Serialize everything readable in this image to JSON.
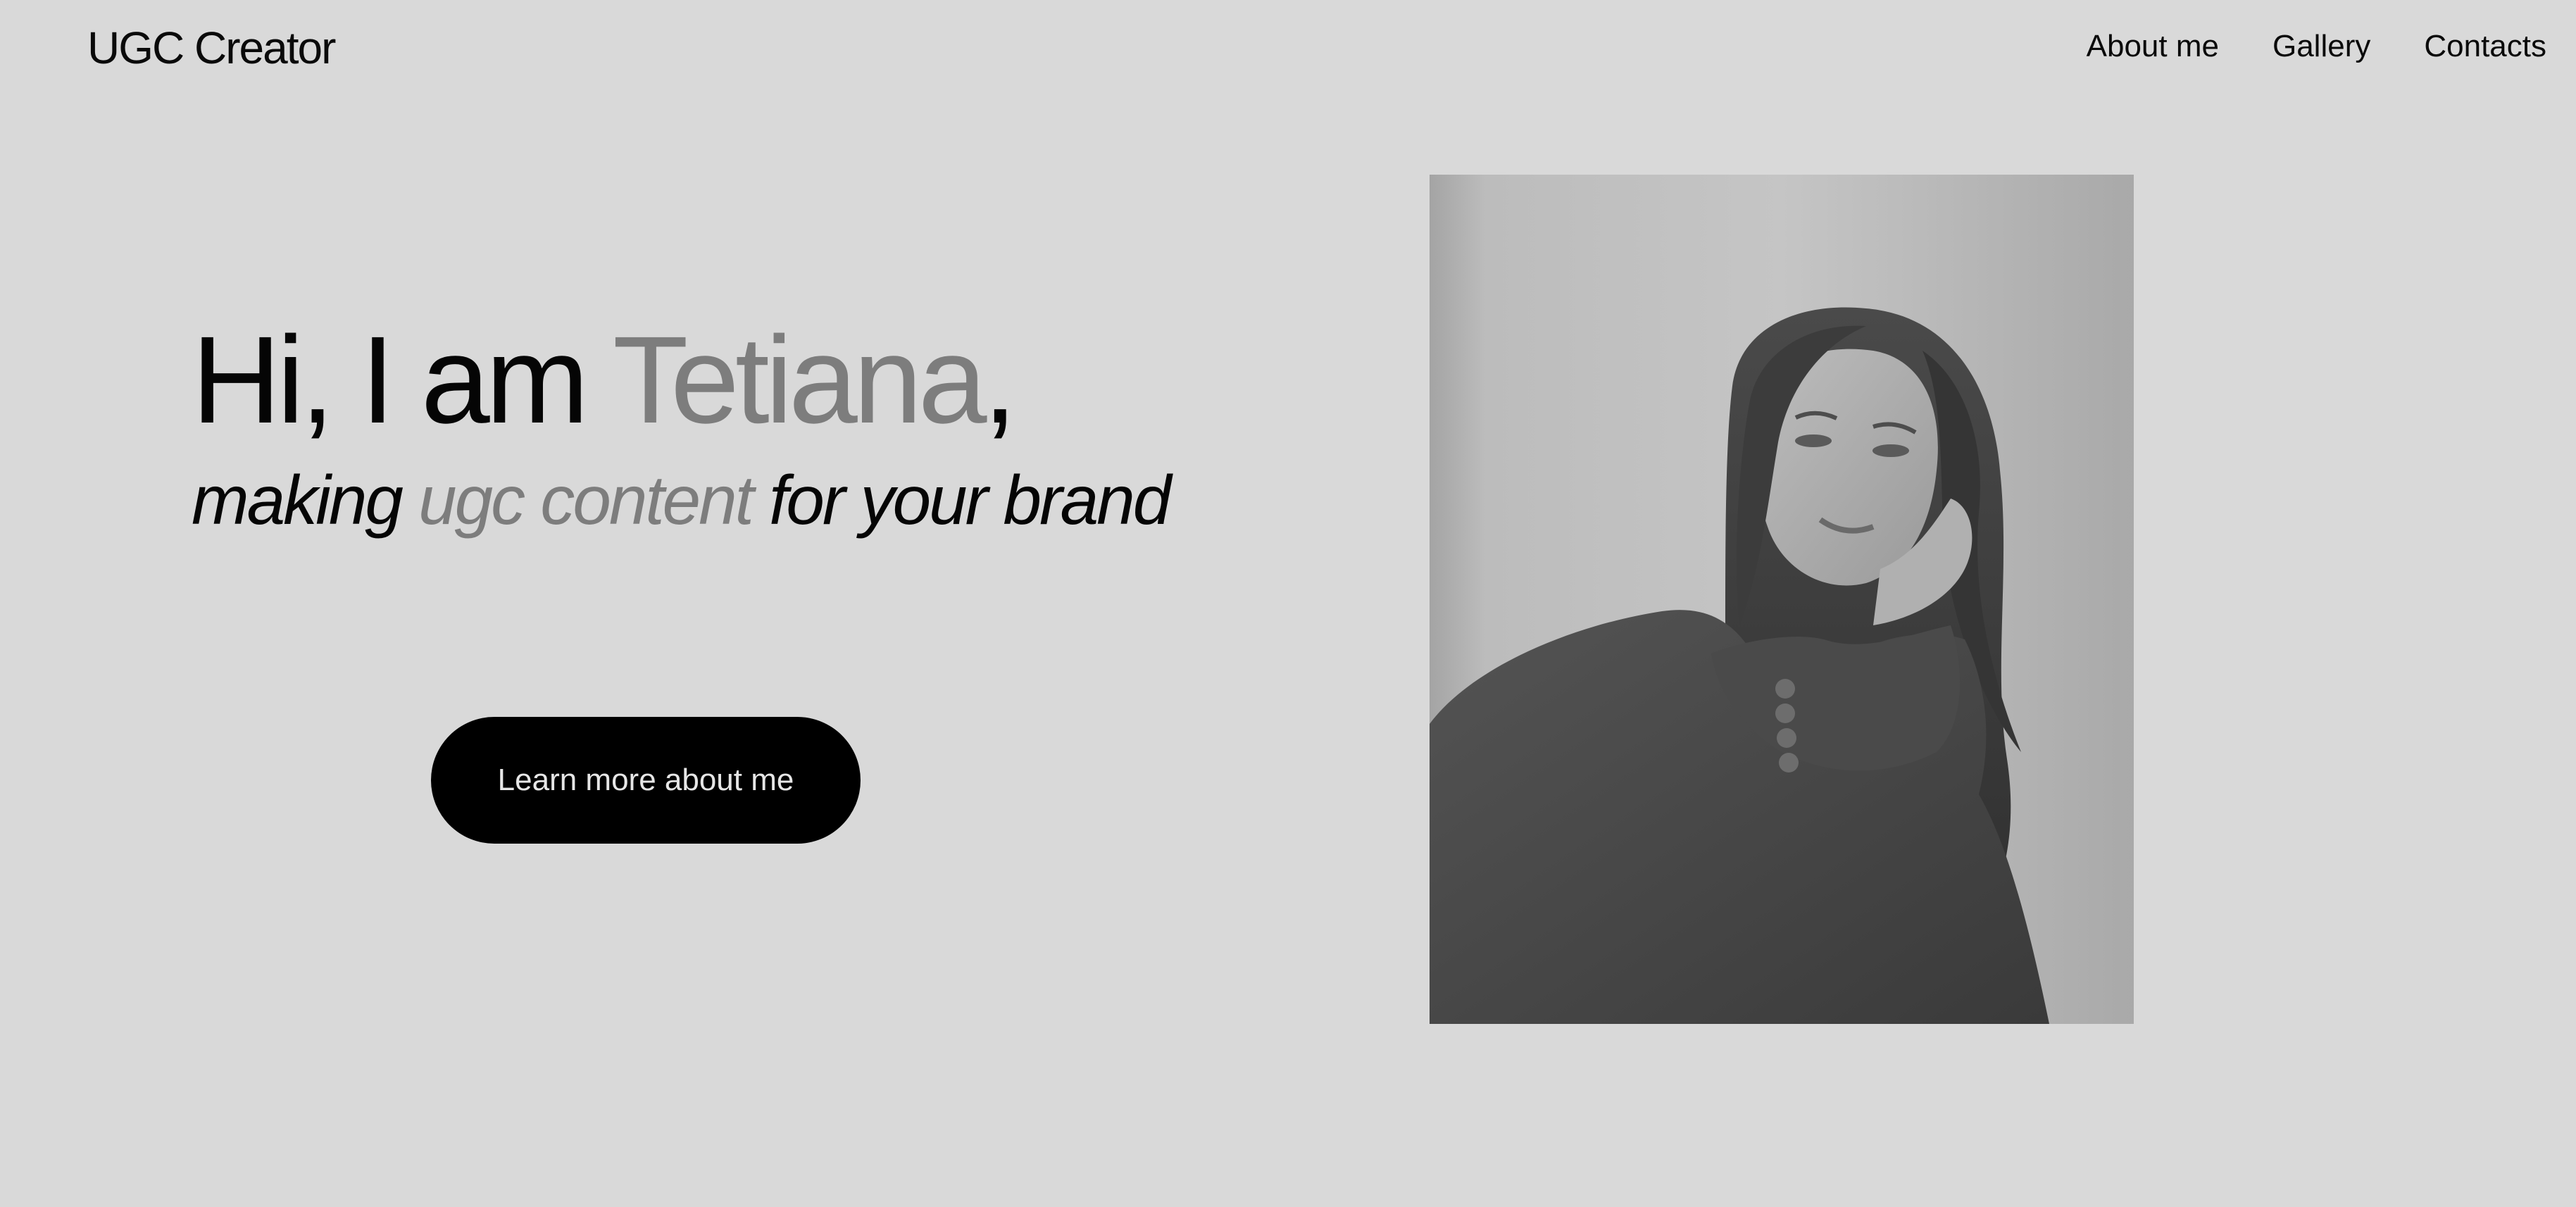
{
  "header": {
    "logo": "UGC Creator",
    "nav": [
      "About me",
      "Gallery",
      "Contacts"
    ]
  },
  "hero": {
    "greeting": "Hi, I am ",
    "name": "Tetiana",
    "name_suffix": ",",
    "subline_start": "making ",
    "subline_highlight": "ugc content",
    "subline_end": " for your brand",
    "cta_label": "Learn more about me"
  },
  "portrait": {
    "description_icon": "portrait-photo"
  },
  "colors": {
    "background": "#d9d9d9",
    "text": "#050505",
    "muted": "#7d7d7d",
    "button": "#000000",
    "button_text": "#e6e6e6"
  }
}
